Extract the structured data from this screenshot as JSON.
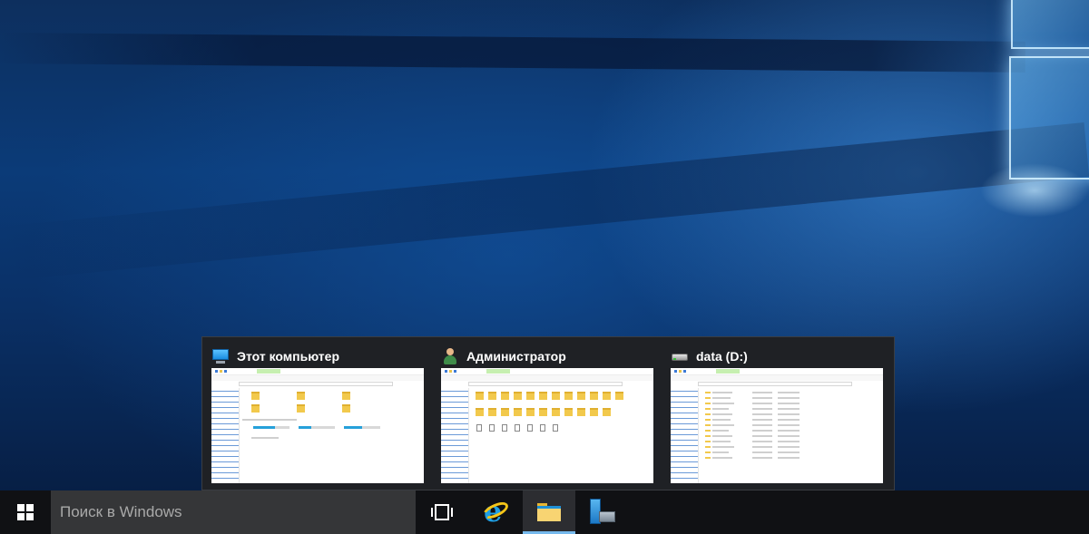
{
  "flyout": {
    "thumbnails": [
      {
        "title": "Этот компьютер",
        "icon": "this-pc-icon"
      },
      {
        "title": "Администратор",
        "icon": "user-folder-icon"
      },
      {
        "title": "data (D:)",
        "icon": "drive-icon"
      }
    ]
  },
  "taskbar": {
    "start_icon": "windows-logo-icon",
    "search_placeholder": "Поиск в Windows",
    "buttons": [
      {
        "name": "task-view",
        "icon": "task-view-icon",
        "active": false
      },
      {
        "name": "internet-explorer",
        "icon": "internet-explorer-icon",
        "active": false
      },
      {
        "name": "file-explorer",
        "icon": "file-explorer-icon",
        "active": true
      },
      {
        "name": "server-manager",
        "icon": "server-manager-icon",
        "active": false
      }
    ],
    "accent_color": "#76b9ed",
    "background_color": "#101114"
  }
}
